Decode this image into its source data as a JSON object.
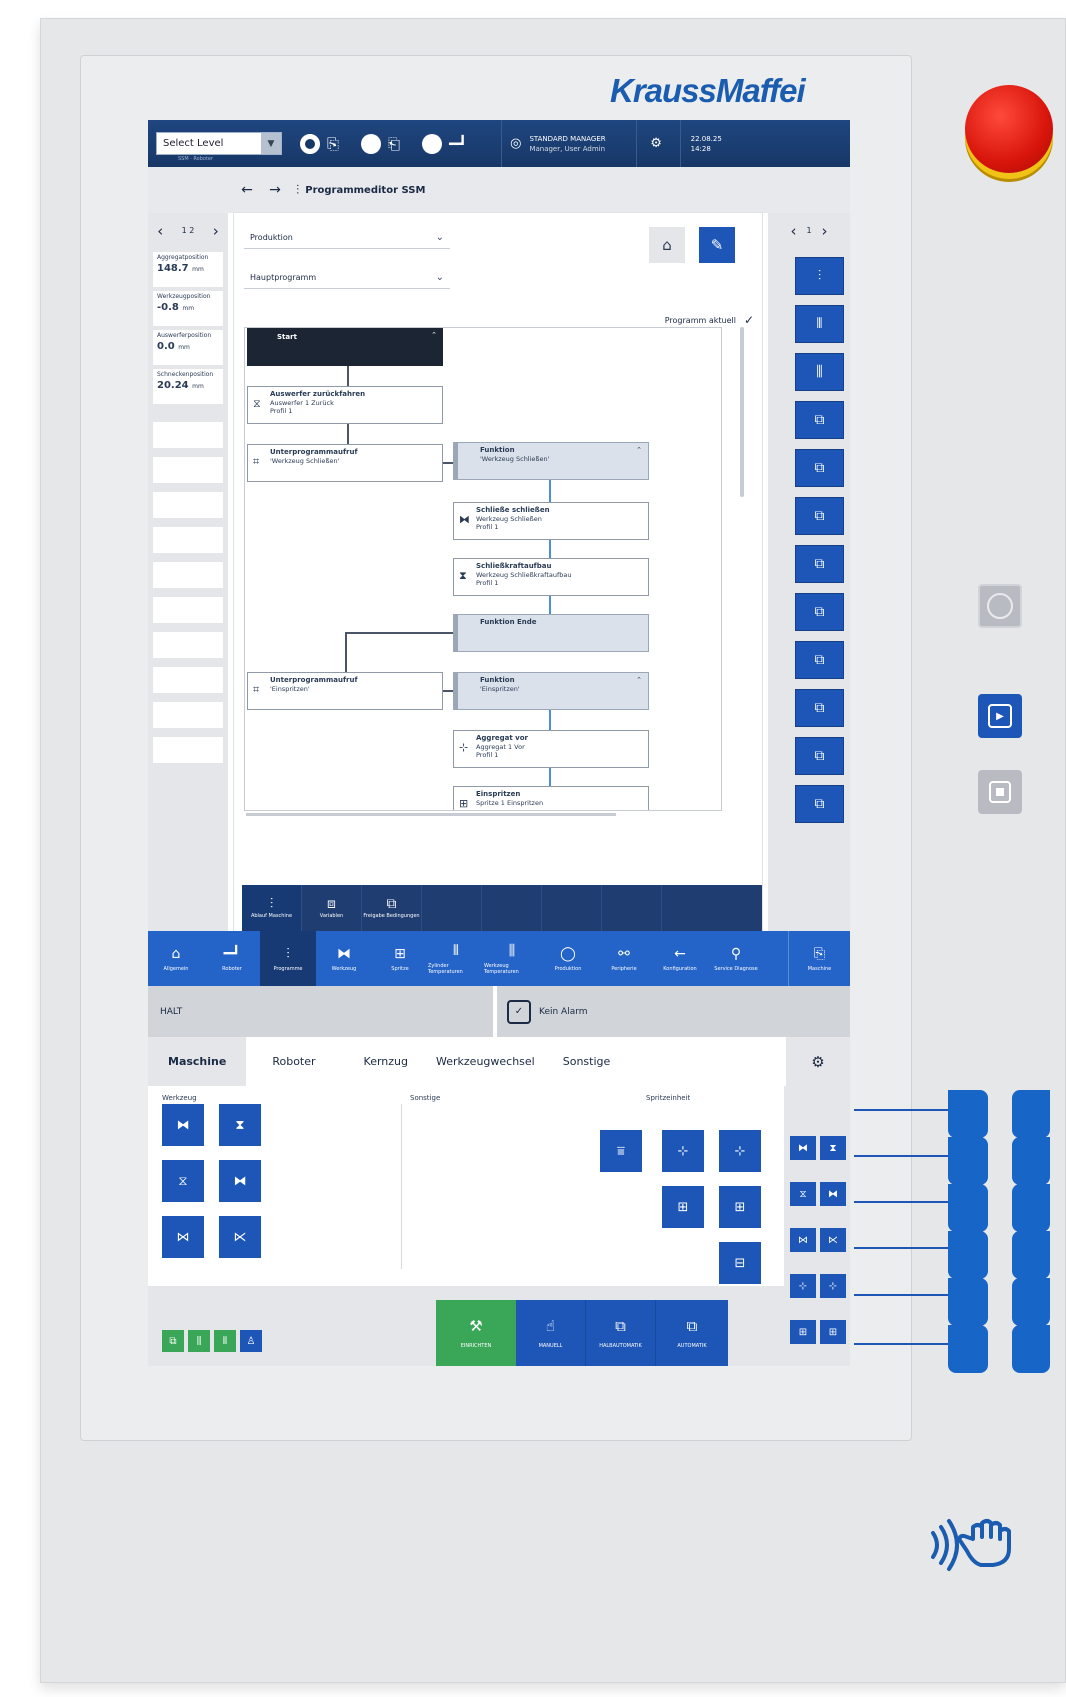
{
  "brand": {
    "name": "KraussMaffei"
  },
  "topbar": {
    "select_level": "Select Level",
    "select_level_sub": "SSM · Roboter",
    "user_title": "STANDARD MANAGER",
    "user_sub": "Manager, User Admin",
    "date": "22.08.25",
    "time": "14:28"
  },
  "nav": {
    "back": "←",
    "forward": "→",
    "title": "Programmeditor SSM"
  },
  "left_panel": {
    "pager": {
      "prev": "‹",
      "page": "1 2",
      "next": "›"
    },
    "params": [
      {
        "label": "Aggregatposition",
        "value": "148.7",
        "unit": "mm"
      },
      {
        "label": "Werkzeugposition",
        "value": "-0.8",
        "unit": "mm"
      },
      {
        "label": "Auswerferposition",
        "value": "0.0",
        "unit": "mm"
      },
      {
        "label": "Schneckenposition",
        "value": "20.24",
        "unit": "mm"
      }
    ]
  },
  "editor": {
    "dropdown1": "Produktion",
    "dropdown2": "Hauptprogramm",
    "status": "Programm aktuell",
    "check": "✓",
    "blocks": [
      {
        "title": "Start",
        "l1": "",
        "l2": ""
      },
      {
        "title": "Auswerfer zurückfahren",
        "l1": "Auswerfer 1 Zurück",
        "l2": "Profil 1"
      },
      {
        "title": "Unterprogrammaufruf",
        "l1": "'Werkzeug Schließen'",
        "l2": ""
      },
      {
        "title": "Funktion",
        "l1": "'Werkzeug Schließen'",
        "l2": ""
      },
      {
        "title": "Schließe schließen",
        "l1": "Werkzeug Schließen",
        "l2": "Profil 1"
      },
      {
        "title": "Schließkraftaufbau",
        "l1": "Werkzeug Schließkraftaufbau",
        "l2": "Profil 1"
      },
      {
        "title": "Funktion Ende",
        "l1": "",
        "l2": ""
      },
      {
        "title": "Unterprogrammaufruf",
        "l1": "'Einspritzen'",
        "l2": ""
      },
      {
        "title": "Funktion",
        "l1": "'Einspritzen'",
        "l2": ""
      },
      {
        "title": "Aggregat vor",
        "l1": "Aggregat 1 Vor",
        "l2": "Profil 1"
      },
      {
        "title": "Einspritzen",
        "l1": "Spritze 1 Einspritzen",
        "l2": ""
      }
    ]
  },
  "right_panel": {
    "pager": {
      "prev": "‹",
      "page": "1",
      "next": "›"
    }
  },
  "sub_menu": [
    {
      "label": "Ablauf Maschine"
    },
    {
      "label": "Variablen"
    },
    {
      "label": "Freigabe Bedingungen"
    }
  ],
  "main_menu": [
    {
      "label": "Allgemein"
    },
    {
      "label": "Roboter"
    },
    {
      "label": "Programme"
    },
    {
      "label": "Werkzeug"
    },
    {
      "label": "Spritze"
    },
    {
      "label": "Zylinder Temperaturen"
    },
    {
      "label": "Werkzeug Temperaturen"
    },
    {
      "label": "Produktion"
    },
    {
      "label": "Peripherie"
    },
    {
      "label": "Konfiguration"
    },
    {
      "label": "Service Diagnose"
    },
    {
      "label": "Maschine"
    }
  ],
  "status": {
    "halt": "HALT",
    "alarm": "Kein Alarm"
  },
  "tabs": [
    "Maschine",
    "Roboter",
    "Kernzug",
    "Werkzeugwechsel",
    "Sonstige"
  ],
  "groups": {
    "werkzeug": "Werkzeug",
    "sonstige": "Sonstige",
    "spritzeinheit": "Spritzeinheit"
  },
  "modes": [
    {
      "label": "EINRICHTEN",
      "color": "#3aa657"
    },
    {
      "label": "MANUELL",
      "color": "#1d56b6"
    },
    {
      "label": "HALBAUTOMATIK",
      "color": "#1d56b6"
    },
    {
      "label": "AUTOMATIK",
      "color": "#1d56b6"
    }
  ],
  "colors": {
    "brand_blue": "#1a5cb0",
    "button_blue": "#1d56b6",
    "topbar": "#173766",
    "green": "#3aa657"
  },
  "icons": {
    "gear": "⚙",
    "nfc": "📶"
  }
}
